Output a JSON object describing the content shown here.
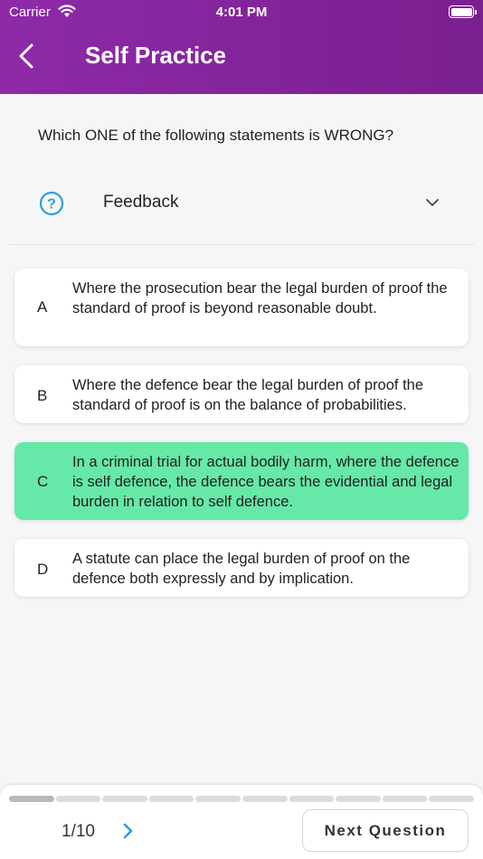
{
  "status_bar": {
    "carrier": "Carrier",
    "time": "4:01 PM"
  },
  "header": {
    "title": "Self Practice"
  },
  "question": "Which ONE of the following statements is WRONG?",
  "feedback": {
    "label": "Feedback"
  },
  "options": [
    {
      "letter": "A",
      "text": "Where the prosecution bear the legal burden of proof the standard of proof is beyond reasonable doubt.",
      "selected": false
    },
    {
      "letter": "B",
      "text": "Where the defence bear the legal burden of proof the standard of proof is on the balance of probabilities.",
      "selected": false
    },
    {
      "letter": "C",
      "text": "In a criminal trial for actual bodily harm, where the defence is self defence, the defence bears the evidential and legal burden in relation to self defence.",
      "selected": true
    },
    {
      "letter": "D",
      "text": "A statute can place the legal burden of proof on the defence both expressly and by implication.",
      "selected": false
    }
  ],
  "footer": {
    "counter": "1/10",
    "next_label": "Next Question",
    "current": 1,
    "total": 10
  },
  "colors": {
    "header": "#8e2aa8",
    "selected_option": "#66e8a8",
    "accent": "#2a9fd6"
  }
}
